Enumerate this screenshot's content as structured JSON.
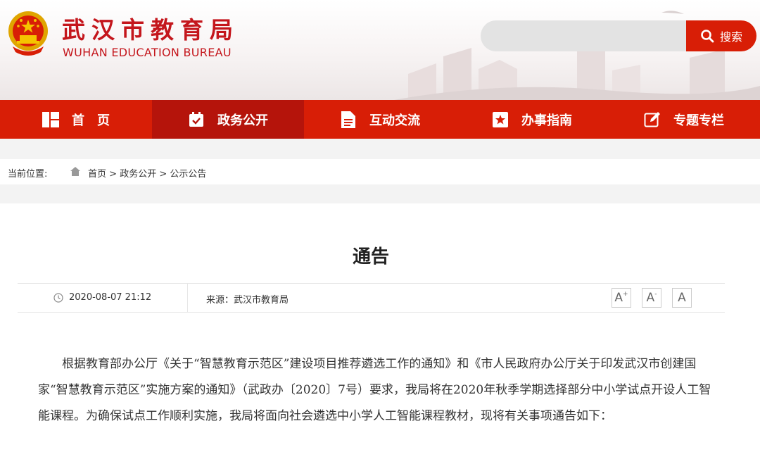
{
  "header": {
    "title_cn": "武汉市教育局",
    "title_en": "WUHAN EDUCATION BUREAU",
    "search": {
      "placeholder": "",
      "button_label": "搜索"
    }
  },
  "nav": {
    "items": [
      {
        "label": "首　页",
        "icon": "home-grid-icon"
      },
      {
        "label": "政务公开",
        "icon": "calendar-check-icon"
      },
      {
        "label": "互动交流",
        "icon": "document-icon"
      },
      {
        "label": "办事指南",
        "icon": "star-tag-icon"
      },
      {
        "label": "专题专栏",
        "icon": "edit-icon"
      }
    ],
    "active_index": 1
  },
  "breadcrumb": {
    "label": "当前位置:",
    "items": [
      "首页",
      "政务公开",
      "公示公告"
    ],
    "separator": ">"
  },
  "article": {
    "title": "通告",
    "date": "2020-08-07 21:12",
    "source": "来源：武汉市教育局",
    "font_buttons": [
      "A+",
      "A-",
      "A"
    ],
    "body": "根据教育部办公厅《关于“智慧教育示范区”建设项目推荐遴选工作的通知》和《市人民政府办公厅关于印发武汉市创建国家“智慧教育示范区”实施方案的通知》（武政办〔2020〕7号）要求，我局将在2020年秋季学期选择部分中小学试点开设人工智能课程。为确保试点工作顺利实施，我局将面向社会遴选中小学人工智能课程教材，现将有关事项通告如下："
  },
  "colors": {
    "brand_red": "#d81e06",
    "nav_active": "#b5140b",
    "title_red": "#c4161c"
  }
}
